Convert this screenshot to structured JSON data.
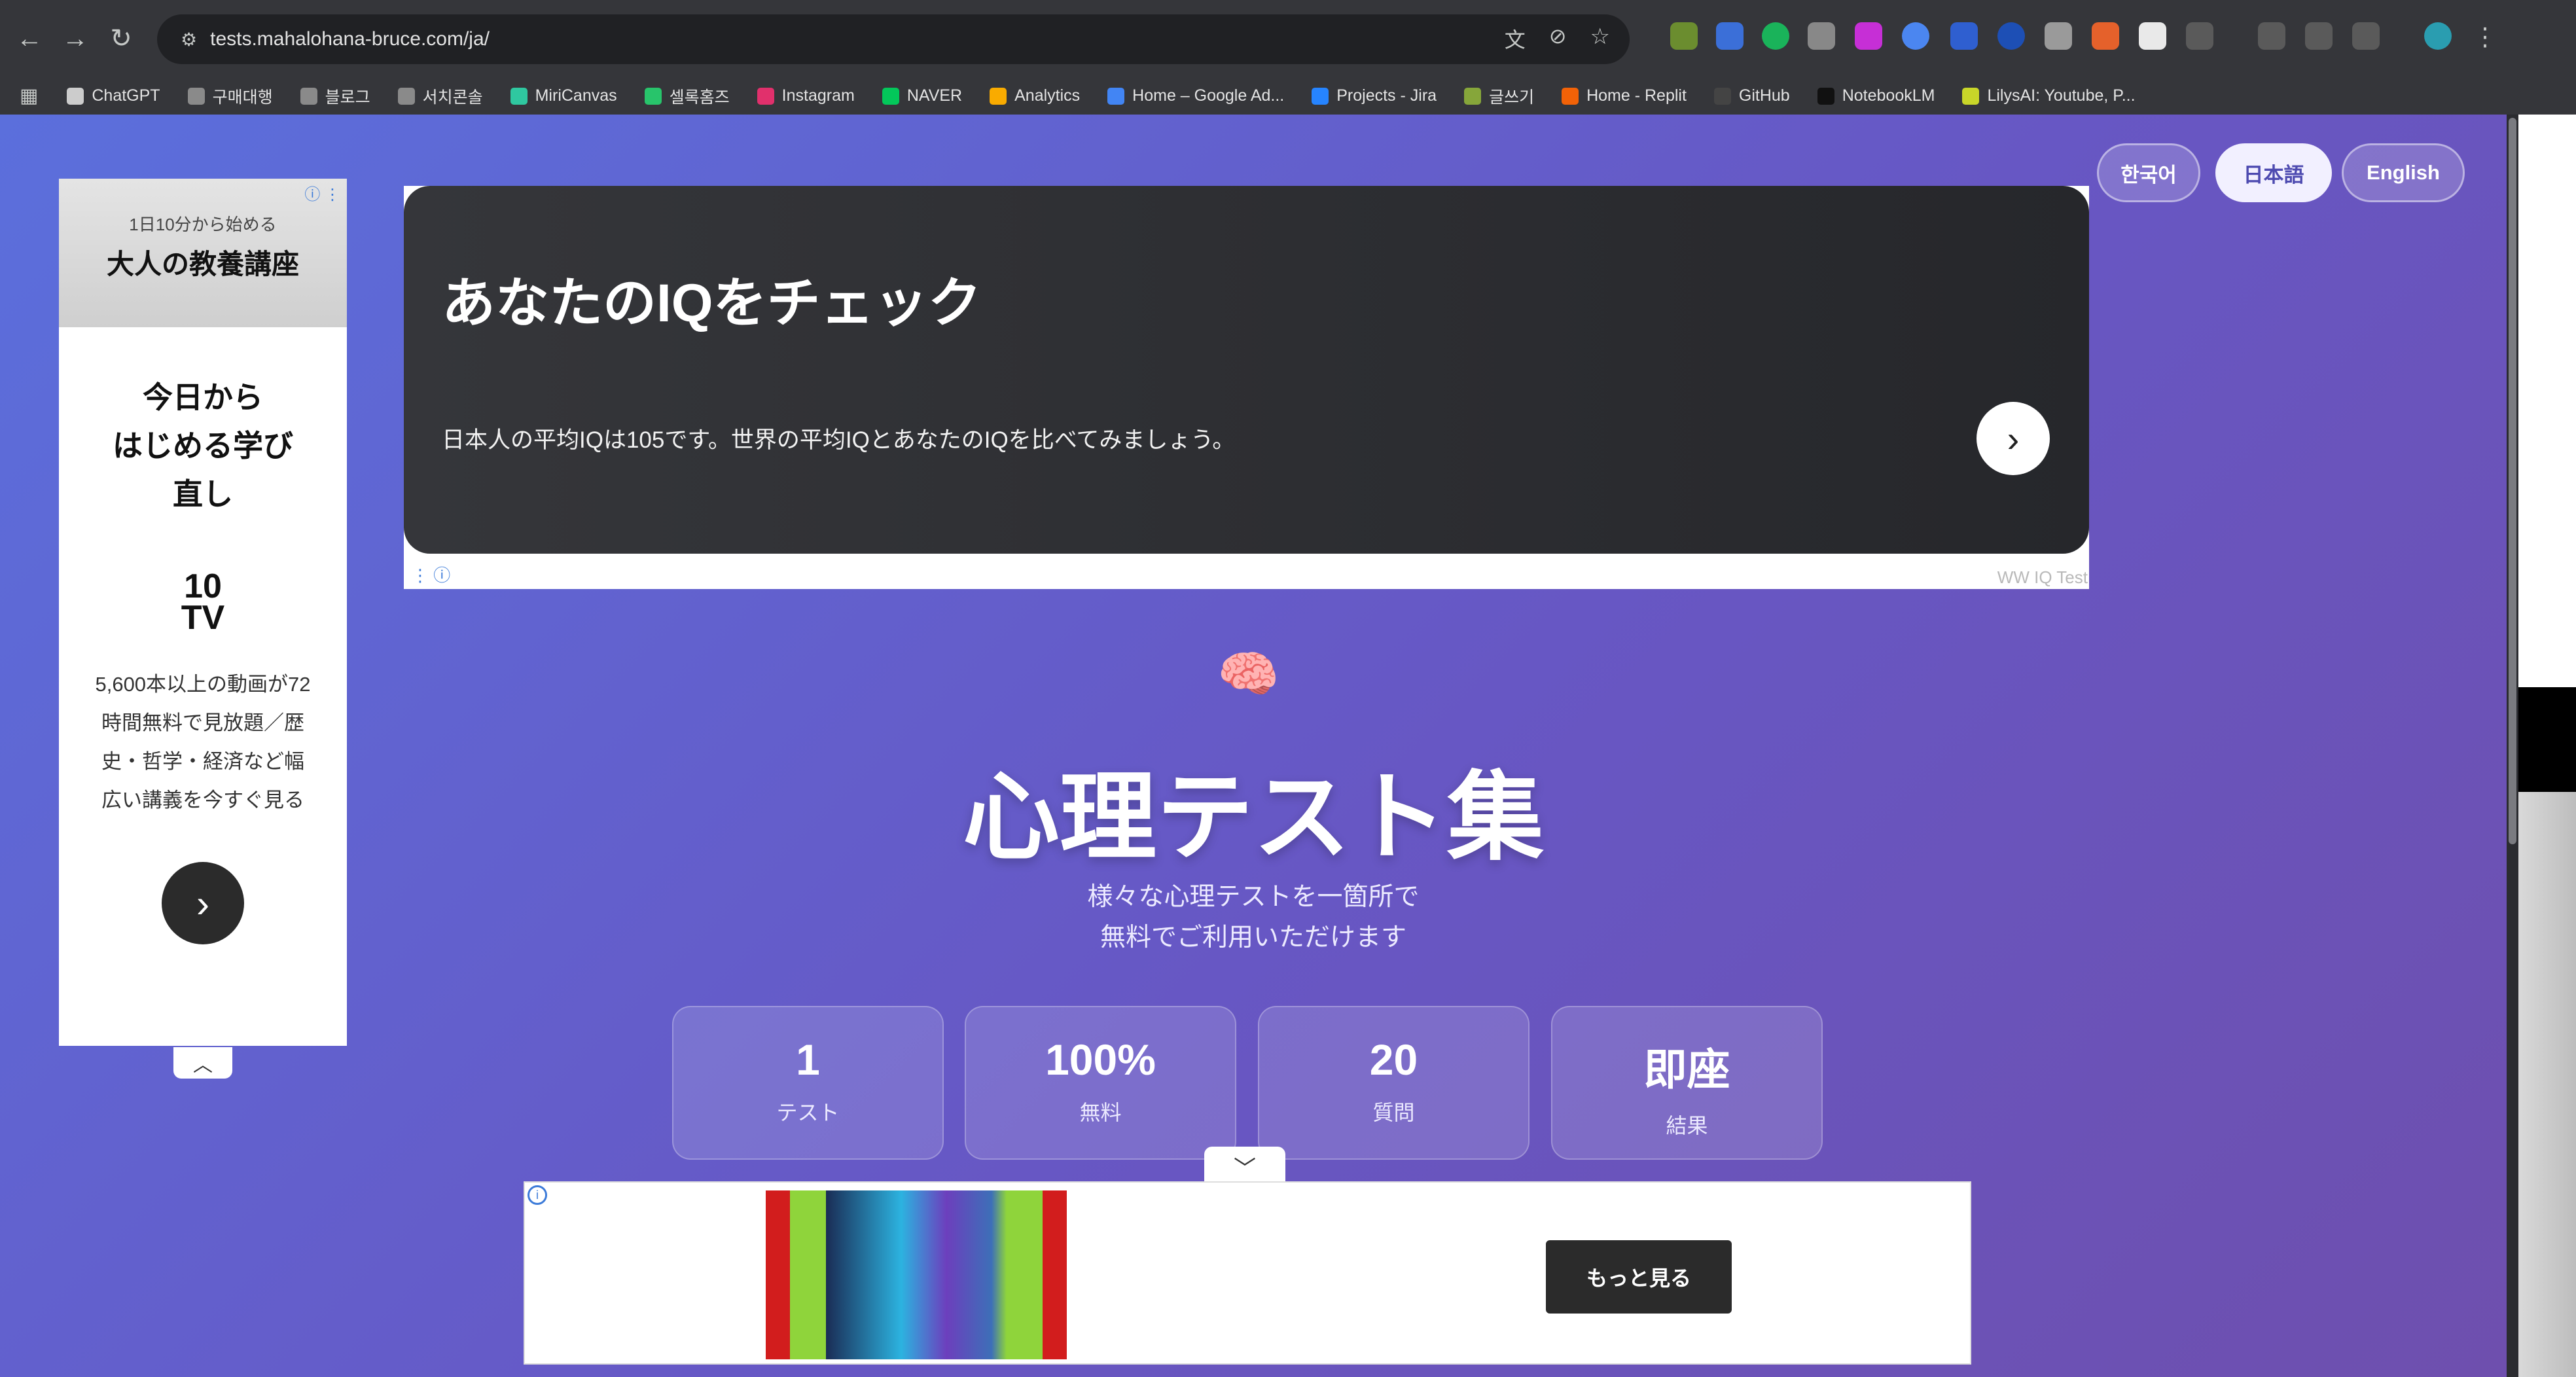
{
  "browser": {
    "url": "tests.mahalohana-bruce.com/ja/",
    "back_icon": "←",
    "forward_icon": "→",
    "reload_icon": "↻",
    "tune_icon": "⚙",
    "translate_icon": "文",
    "eye_off_icon": "⊘",
    "star_icon": "☆",
    "menu_icon": "⋮",
    "bookmarks": [
      {
        "label": "ChatGPT",
        "color": "#cccccc"
      },
      {
        "label": "구매대행",
        "color": "#8a8a8a"
      },
      {
        "label": "블로그",
        "color": "#8a8a8a"
      },
      {
        "label": "서치콘솔",
        "color": "#8a8a8a"
      },
      {
        "label": "MiriCanvas",
        "color": "#2fc8a0"
      },
      {
        "label": "셀록홈즈",
        "color": "#28c46b"
      },
      {
        "label": "Instagram",
        "color": "#e1306c"
      },
      {
        "label": "NAVER",
        "color": "#03c75a"
      },
      {
        "label": "Analytics",
        "color": "#f9ab00"
      },
      {
        "label": "Home – Google Ad...",
        "color": "#4285f4"
      },
      {
        "label": "Projects - Jira",
        "color": "#2684ff"
      },
      {
        "label": "글쓰기",
        "color": "#86a63a"
      },
      {
        "label": "Home - Replit",
        "color": "#f26207"
      },
      {
        "label": "GitHub",
        "color": "#444444"
      },
      {
        "label": "NotebookLM",
        "color": "#111111"
      },
      {
        "label": "LilysAI: Youtube, P...",
        "color": "#c8d629"
      }
    ]
  },
  "languages": [
    {
      "label": "한국어",
      "active": false
    },
    {
      "label": "日本語",
      "active": true
    },
    {
      "label": "English",
      "active": false
    }
  ],
  "side_ad": {
    "small": "1日10分から始める",
    "big": "大人の教養講座",
    "headline_1": "今日から",
    "headline_2": "はじめる学び",
    "headline_3": "直し",
    "logo_1": "10",
    "logo_2": "TV",
    "desc_1": "5,600本以上の動画が72",
    "desc_2": "時間無料で見放題／歴",
    "desc_3": "史・哲学・経済など幅",
    "desc_4": "広い講義を今すぐ見る",
    "next": "›",
    "info": "ⓘ ⋮",
    "collapse": "︿"
  },
  "top_ad": {
    "title": "あなたのIQをチェック",
    "desc": "日本人の平均IQは105です。世界の平均IQとあなたのIQを比べてみましょう。",
    "next": "›",
    "source": "WW IQ Test",
    "icons": "⋮ ⓘ"
  },
  "hero": {
    "emoji": "🧠",
    "title": "心理テスト集",
    "subtitle_1": "様々な心理テストを一箇所で",
    "subtitle_2": "無料でご利用いただけます"
  },
  "stats": [
    {
      "value": "1",
      "label": "テスト"
    },
    {
      "value": "100%",
      "label": "無料"
    },
    {
      "value": "20",
      "label": "質問"
    },
    {
      "value": "即座",
      "label": "結果"
    }
  ],
  "bottom_ad": {
    "button": "もっと見る",
    "collapse": "﹀",
    "badge": "i"
  }
}
